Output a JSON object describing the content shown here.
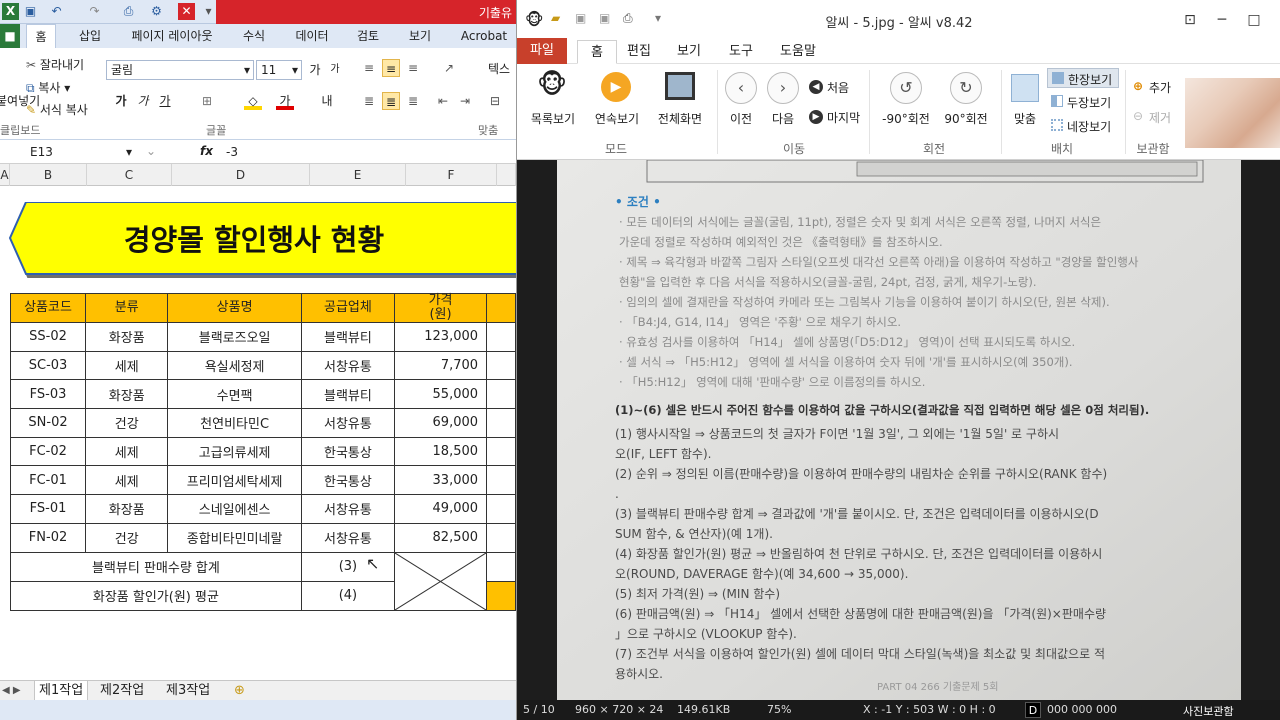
{
  "excel": {
    "title_text": "기출유",
    "tabs": [
      "홈",
      "삽입",
      "페이지 레이아웃",
      "수식",
      "데이터",
      "검토",
      "보기",
      "Acrobat"
    ],
    "ribbon": {
      "cut": "잘라내기",
      "copy": "복사",
      "format_painter": "서식 복사",
      "paste_short": "붙여넣기",
      "font_name": "굴림",
      "font_size": "11",
      "bold": "가",
      "italic": "가",
      "underline": "가",
      "font_color": "가",
      "wrap_short": "텍스",
      "group_clipboard": "클립보드",
      "group_font": "글꼴",
      "group_align": "맞춤"
    },
    "formula": {
      "cell_ref": "E13",
      "fx": "fx",
      "value": "-3"
    },
    "columns": [
      "A",
      "B",
      "C",
      "D",
      "E",
      "F"
    ],
    "banner_title": "경양몰 할인행사 현황",
    "table": {
      "headers": [
        "상품코드",
        "분류",
        "상품명",
        "공급업체",
        "가격\n(원)"
      ],
      "rows": [
        [
          "SS-02",
          "화장품",
          "블랙로즈오일",
          "블랙뷰티",
          "123,000"
        ],
        [
          "SC-03",
          "세제",
          "욕실세정제",
          "서창유통",
          "7,700"
        ],
        [
          "FS-03",
          "화장품",
          "수면팩",
          "블랙뷰티",
          "55,000"
        ],
        [
          "SN-02",
          "건강",
          "천연비타민C",
          "서창유통",
          "69,000"
        ],
        [
          "FC-02",
          "세제",
          "고급의류세제",
          "한국통상",
          "18,500"
        ],
        [
          "FC-01",
          "세제",
          "프리미엄세탁세제",
          "한국통상",
          "33,000"
        ],
        [
          "FS-01",
          "화장품",
          "스네일에센스",
          "서창유통",
          "49,000"
        ],
        [
          "FN-02",
          "건강",
          "종합비타민미네랄",
          "서창유통",
          "82,500"
        ]
      ],
      "summary": [
        {
          "label": "블랙뷰티 판매수량 합계",
          "value": "(3)"
        },
        {
          "label": "화장품 할인가(원) 평균",
          "value": "(4)"
        }
      ]
    },
    "sheet_tabs": [
      "제1작업",
      "제2작업",
      "제3작업"
    ]
  },
  "viewer": {
    "title": "알씨 - 5.jpg - 알씨 v8.42",
    "tabs": [
      "파일",
      "홈",
      "편집",
      "보기",
      "도구",
      "도움말"
    ],
    "ribbon": {
      "list_view": "목록보기",
      "slideshow": "연속보기",
      "fullscreen": "전체화면",
      "prev": "이전",
      "next": "다음",
      "first": "처음",
      "last": "마지막",
      "rotate_left": "-90°회전",
      "rotate_right": "90°회전",
      "fit": "맞춤",
      "single_view": "한장보기",
      "double_view": "두장보기",
      "quad_view": "네장보기",
      "add": "추가",
      "remove": "제거",
      "groups": [
        "모드",
        "이동",
        "회전",
        "배치",
        "보관함"
      ]
    },
    "document": {
      "section_title": "• 조건 •",
      "bullets": [
        "모든 데이터의 서식에는 글꼴(굴림, 11pt), 정렬은 숫자 및 회계 서식은 오른쪽 정렬, 나머지 서식은 가운데 정렬로 작성하며 예외적인 것은 《출력형태》를 참조하시오.",
        "제목 ⇒ 육각형과 바깥쪽 그림자 스타일(오프셋 대각선 오른쪽 아래)을 이용하여 작성하고 \"경양몰 할인행사 현황\"을 입력한 후 다음 서식을 적용하시오(글꼴-굴림, 24pt, 검정, 굵게, 채우기-노랑).",
        "임의의 셀에 결재란을 작성하여 카메라 또는 그림복사 기능을 이용하여 붙이기 하시오(단, 원본 삭제).",
        "「B4:J4, G14, I14」 영역은 '주황' 으로 채우기 하시오.",
        "유효성 검사를 이용하여 「H14」 셀에 상품명(「D5:D12」 영역)이 선택 표시되도록 하시오.",
        "셀 서식 ⇒ 「H5:H12」 영역에 셀 서식을 이용하여 숫자 뒤에 '개'를 표시하시오(예 350개).",
        "「H5:H12」 영역에 대해 '판매수량' 으로 이름정의를 하시오."
      ],
      "instruction": "(1)~(6) 셀은 반드시 주어진 함수를 이용하여 값을 구하시오(결과값을 직접 입력하면 해당 셀은 0점 처리됨).",
      "items": [
        "(1) 행사시작일 ⇒ 상품코드의 첫 글자가 F이면 '1월 3일', 그 외에는 '1월 5일' 로 구하시오(IF, LEFT 함수).",
        "(2) 순위 ⇒ 정의된 이름(판매수량)을 이용하여 판매수량의 내림차순 순위를 구하시오(RANK 함수).",
        "(3) 블랙뷰티 판매수량 합계 ⇒ 결과값에 '개'를 붙이시오. 단, 조건은 입력데이터를 이용하시오(DSUM 함수, & 연산자)(예 1개).",
        "(4) 화장품 할인가(원) 평균 ⇒ 반올림하여 천 단위로 구하시오. 단, 조건은 입력데이터를 이용하시오(ROUND, DAVERAGE 함수)(예 34,600 → 35,000).",
        "(5) 최저 가격(원) ⇒ (MIN 함수)",
        "(6) 판매금액(원) ⇒ 「H14」 셀에서 선택한 상품명에 대한 판매금액(원)을 「가격(원)×판매수량」으로 구하시오 (VLOOKUP 함수).",
        "(7) 조건부 서식을 이용하여 할인가(원) 셀에 데이터 막대 스타일(녹색)을 최소값 및 최대값으로 적용하시오."
      ],
      "footer": "PART 04  266  기출문제 5회"
    },
    "status": {
      "index": "5 / 10",
      "dims": "960 × 720 × 24",
      "size": "149.61KB",
      "zoom": "75%",
      "coords": "X : -1  Y : 503  W : 0  H : 0",
      "color": "000 000 000",
      "album": "사진보관함"
    }
  }
}
